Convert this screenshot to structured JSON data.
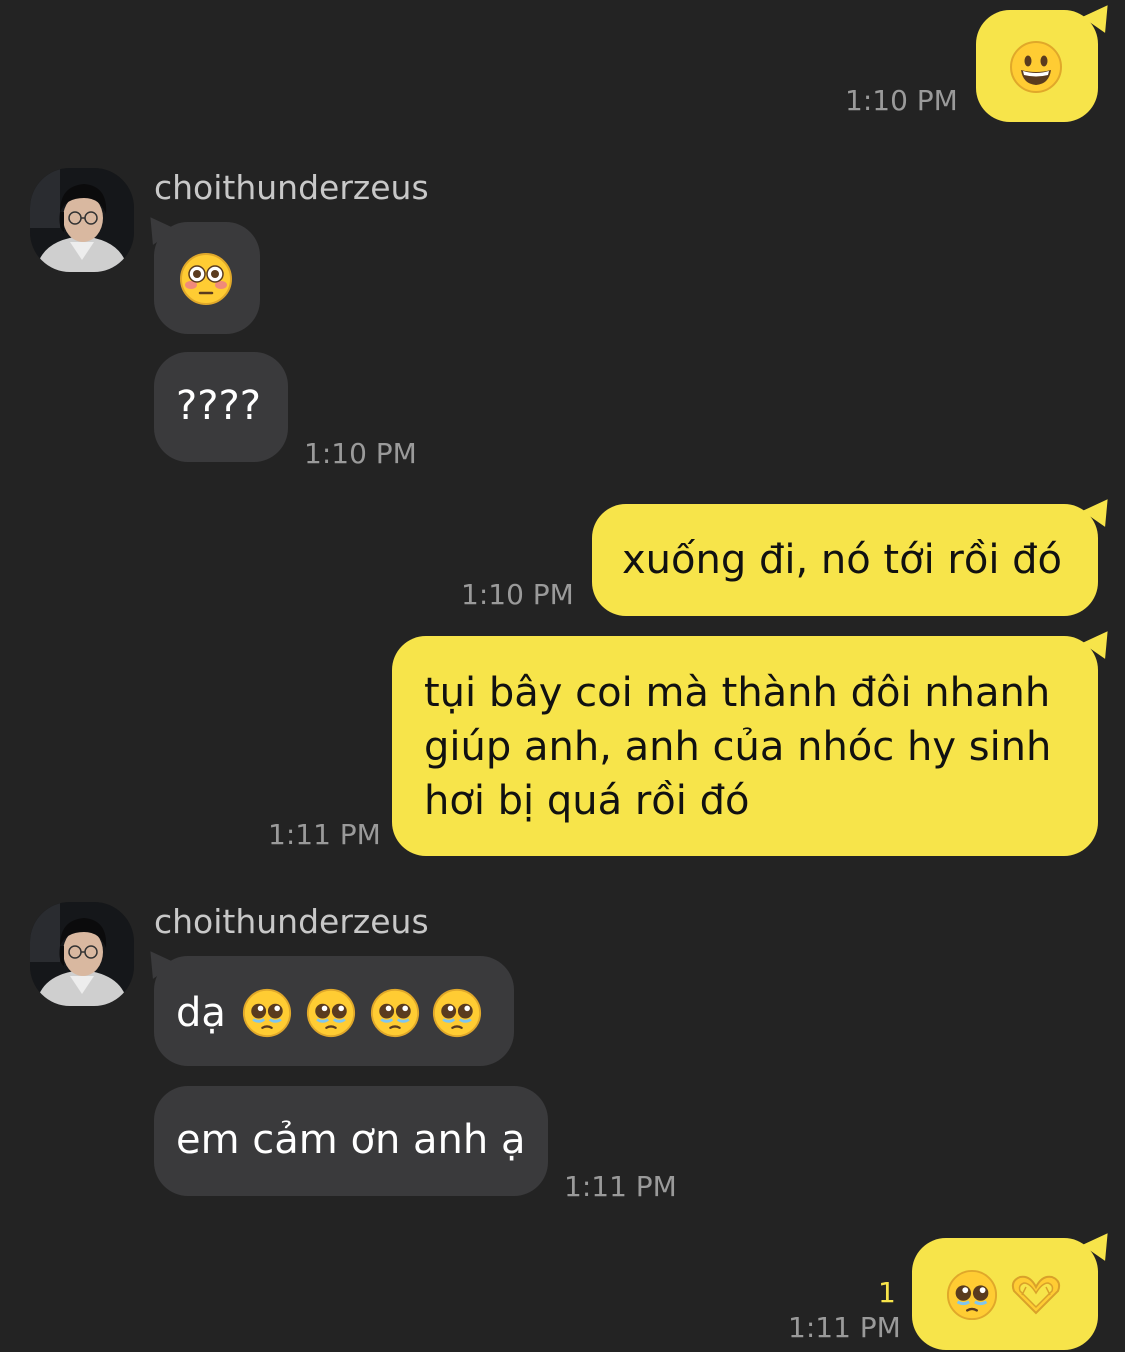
{
  "chat": {
    "messages": [
      {
        "from": "me",
        "emoji": "grinning-face",
        "time": "1:10 PM"
      },
      {
        "from": "them",
        "sender": "choithunderzeus",
        "emoji": "flushed-face"
      },
      {
        "from": "them",
        "text": "????",
        "time": "1:10 PM"
      },
      {
        "from": "me",
        "text": "xuống đi, nó tới rồi đó",
        "time": "1:10 PM"
      },
      {
        "from": "me",
        "lines": [
          "tụi bây coi mà thành đôi nhanh",
          "giúp anh, anh của nhóc hy sinh",
          "hơi bị quá rồi đó"
        ],
        "time": "1:11 PM"
      },
      {
        "from": "them",
        "sender": "choithunderzeus",
        "text": "dạ",
        "emojis": [
          "pleading-face",
          "pleading-face",
          "pleading-face",
          "pleading-face"
        ]
      },
      {
        "from": "them",
        "text": "em cảm ơn anh ạ",
        "time": "1:11 PM"
      },
      {
        "from": "me",
        "emojis": [
          "pleading-face",
          "heart-hands"
        ],
        "unread": "1",
        "time": "1:11 PM"
      }
    ]
  },
  "colors": {
    "background": "#232323",
    "my_bubble": "#F7E44A",
    "their_bubble": "#3A3A3C",
    "timestamp": "#9A9A9A"
  }
}
